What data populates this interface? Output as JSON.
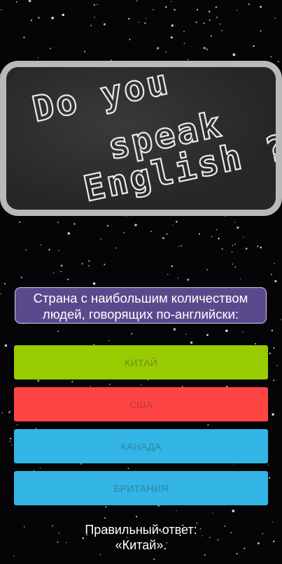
{
  "banner": {
    "lines": [
      "Do you",
      "speak",
      "English ?"
    ]
  },
  "question": {
    "line1": "Страна с наибольшим количеством",
    "line2": "людей, говорящих по-английски:"
  },
  "answers": [
    {
      "label": "КИТАЙ",
      "color": "#99cc00"
    },
    {
      "label": "США",
      "color": "#ff4444"
    },
    {
      "label": "КАНАДА",
      "color": "#33b5e5"
    },
    {
      "label": "БРИТАНИЯ",
      "color": "#33b5e5"
    }
  ],
  "result": {
    "line1": "Правильный ответ:",
    "line2": "«Китай»."
  }
}
